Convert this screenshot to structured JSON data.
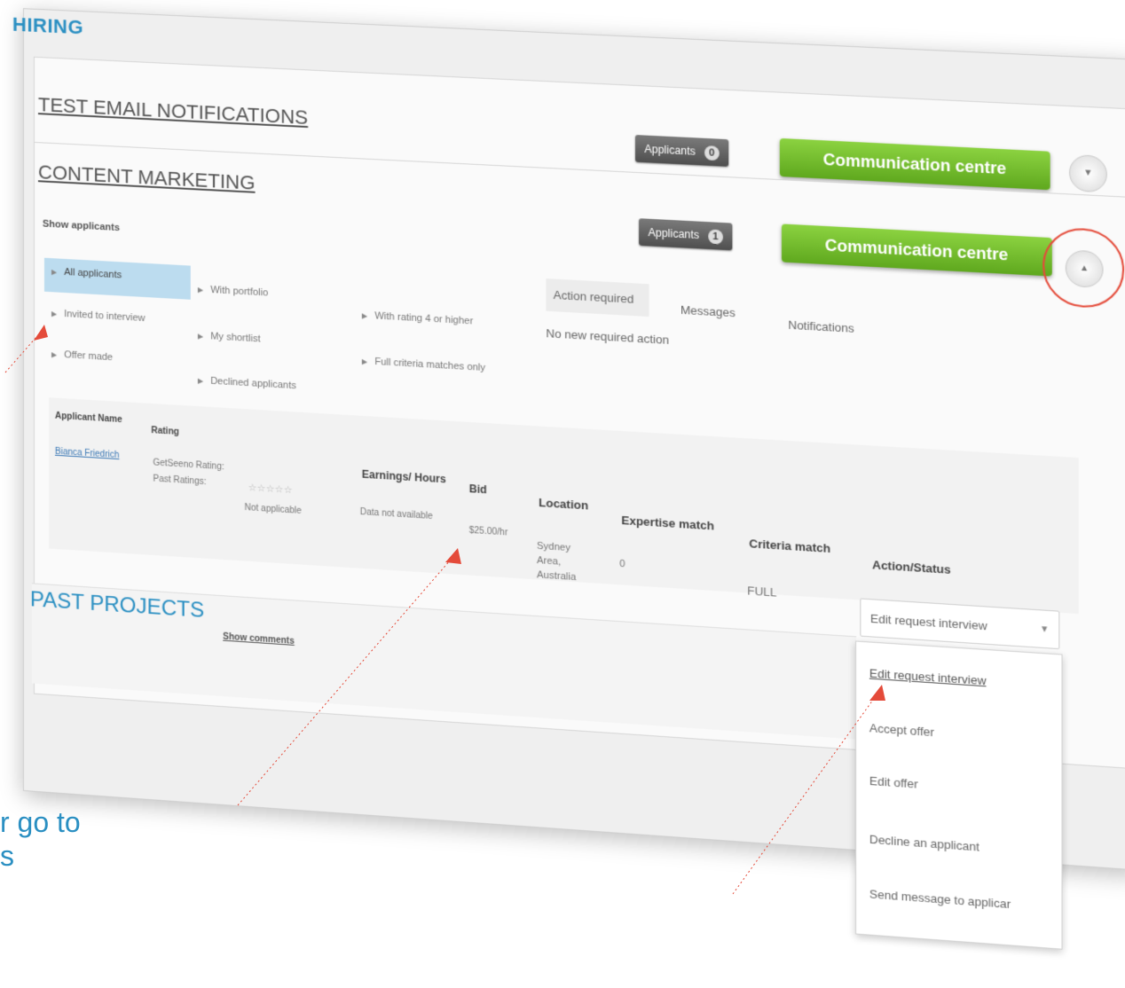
{
  "section_title": "HIRING",
  "projects": [
    {
      "title": "TEST EMAIL NOTIFICATIONS",
      "applicants_label": "Applicants",
      "applicants_count": "0",
      "comm_label": "Communication centre",
      "toggle_icon": "chevron-down-icon"
    },
    {
      "title": "CONTENT MARKETING",
      "applicants_label": "Applicants",
      "applicants_count": "1",
      "comm_label": "Communication centre",
      "toggle_icon": "chevron-up-icon"
    }
  ],
  "show_applicants_label": "Show applicants",
  "filters": {
    "col1": [
      "All applicants",
      "Invited to interview",
      "Offer made"
    ],
    "col2": [
      "With portfolio",
      "My shortlist",
      "Declined applicants"
    ],
    "col3": [
      "With rating 4 or higher",
      "Full criteria matches only"
    ]
  },
  "tabs": [
    "Action required",
    "Messages",
    "Notifications"
  ],
  "no_action_text": "No new required action",
  "table": {
    "headers": [
      "Applicant Name",
      "Rating",
      "Earnings/ Hours",
      "Bid",
      "Location",
      "Expertise match",
      "Criteria match",
      "Action/Status"
    ],
    "row": {
      "name": "Bianca Friedrich",
      "rating_label_1": "GetSeeno Rating:",
      "rating_label_2": "Past Ratings:",
      "rating_stars": "☆☆☆☆☆",
      "past_ratings": "Not applicable",
      "earnings": "Data not available",
      "bid": "$25.00/hr",
      "location": [
        "Sydney",
        "Area,",
        "Australia"
      ],
      "expertise": "0",
      "criteria": "FULL"
    }
  },
  "action_select": {
    "value": "Edit request interview",
    "options": [
      "Edit request interview",
      "Accept offer",
      "Edit offer",
      "Decline an applicant",
      "Send message to applicar"
    ]
  },
  "past_projects": {
    "title": "PAST PROJECTS",
    "show_comments": "Show comments"
  },
  "caption": [
    "r go to",
    "s"
  ],
  "colors": {
    "accent_blue": "#2a8fc2",
    "green_button": "#6cbf2a",
    "red_annotation": "#e44b3a"
  }
}
